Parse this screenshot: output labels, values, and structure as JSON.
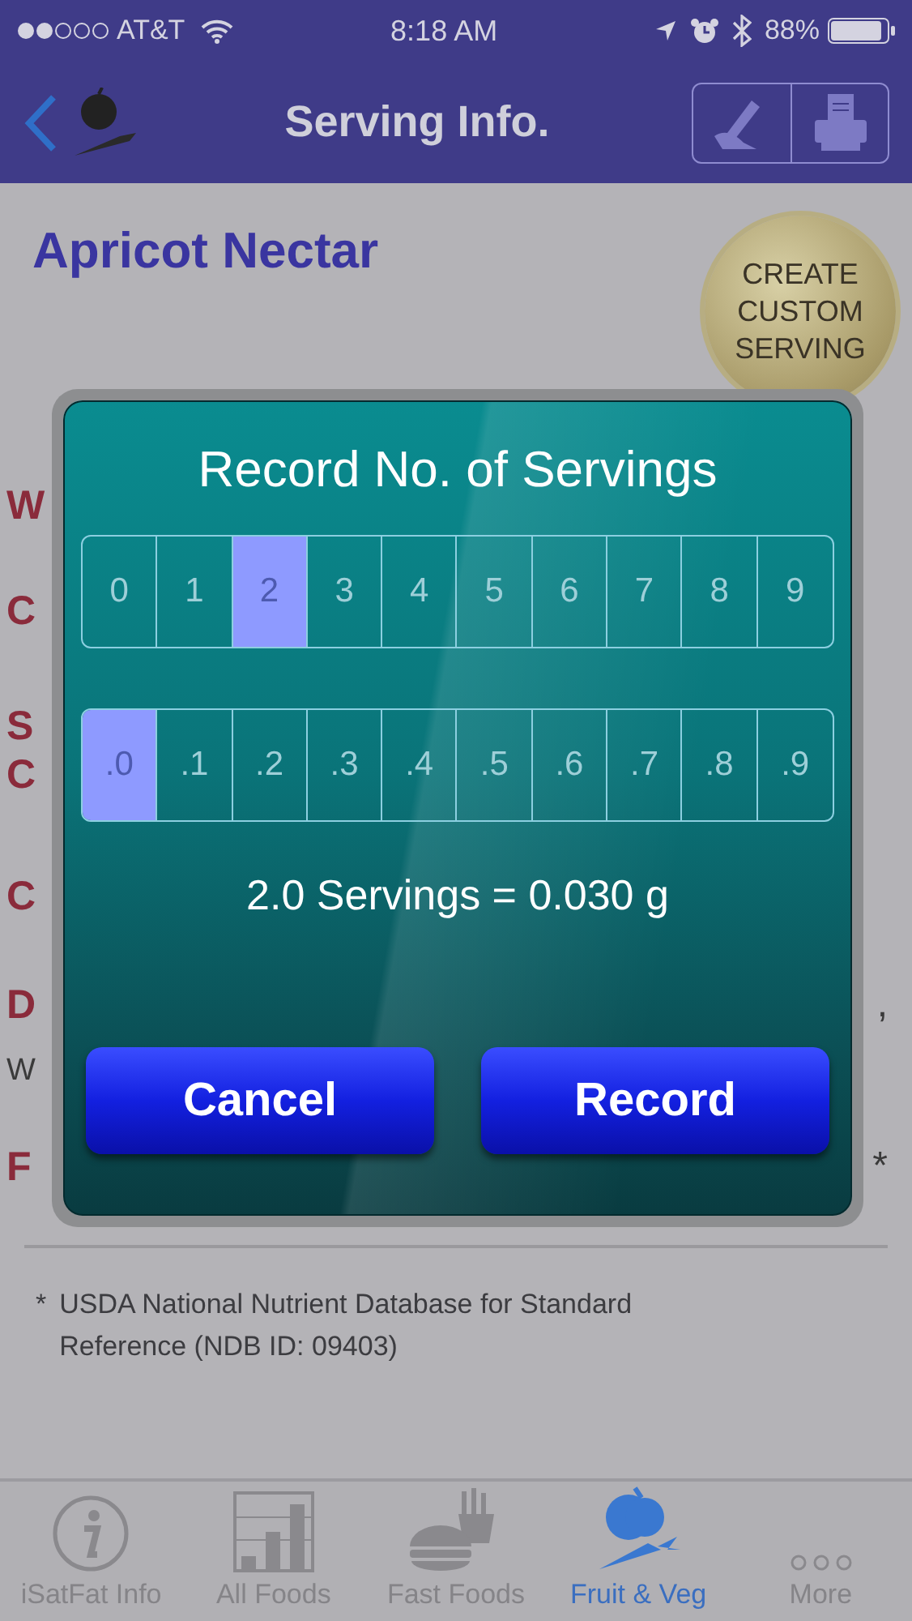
{
  "status_bar": {
    "carrier": "AT&T",
    "time": "8:18 AM",
    "battery": "88%"
  },
  "nav": {
    "title": "Serving Info."
  },
  "food": {
    "name": "Apricot Nectar",
    "badge": "CREATE CUSTOM SERVING"
  },
  "background_fragments": [
    {
      "kind": "heading",
      "left": "W"
    },
    {
      "kind": "heading",
      "left": "C"
    },
    {
      "kind": "heading",
      "left": "S"
    },
    {
      "kind": "heading",
      "left": "C"
    },
    {
      "kind": "heading",
      "left": "C"
    },
    {
      "kind": "heading",
      "left": "D",
      "right": ","
    },
    {
      "kind": "text",
      "left": "W"
    },
    {
      "kind": "heading",
      "left": "F",
      "right": "*"
    }
  ],
  "dialog": {
    "title": "Record No. of Servings",
    "whole": [
      {
        "label": "0",
        "selected": false
      },
      {
        "label": "1",
        "selected": false
      },
      {
        "label": "2",
        "selected": true
      },
      {
        "label": "3",
        "selected": false
      },
      {
        "label": "4",
        "selected": false
      },
      {
        "label": "5",
        "selected": false
      },
      {
        "label": "6",
        "selected": false
      },
      {
        "label": "7",
        "selected": false
      },
      {
        "label": "8",
        "selected": false
      },
      {
        "label": "9",
        "selected": false
      }
    ],
    "tenths": [
      {
        "label": ".0",
        "selected": true
      },
      {
        "label": ".1",
        "selected": false
      },
      {
        "label": ".2",
        "selected": false
      },
      {
        "label": ".3",
        "selected": false
      },
      {
        "label": ".4",
        "selected": false
      },
      {
        "label": ".5",
        "selected": false
      },
      {
        "label": ".6",
        "selected": false
      },
      {
        "label": ".7",
        "selected": false
      },
      {
        "label": ".8",
        "selected": false
      },
      {
        "label": ".9",
        "selected": false
      }
    ],
    "summary": "2.0 Servings = 0.030 g",
    "buttons": [
      "Cancel",
      "Record"
    ]
  },
  "footnote": {
    "mark": "*",
    "text": "USDA National Nutrient Database for Standard Reference (NDB ID: 09403)"
  },
  "tab_bar": [
    {
      "kind": "info",
      "label": "iSatFat Info",
      "selected": false
    },
    {
      "kind": "chart",
      "label": "All Foods",
      "selected": false
    },
    {
      "kind": "fastfood",
      "label": "Fast Foods",
      "selected": false
    },
    {
      "kind": "fruit",
      "label": "Fruit & Veg",
      "selected": true
    },
    {
      "kind": "more",
      "label": "More",
      "selected": false
    }
  ]
}
